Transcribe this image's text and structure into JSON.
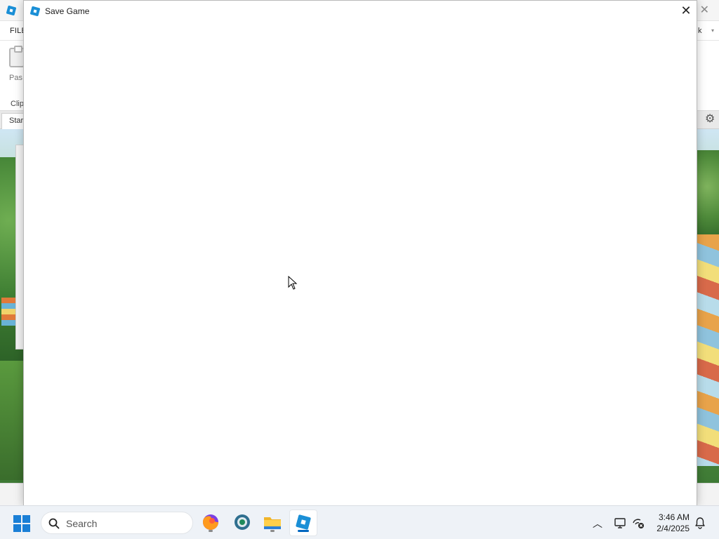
{
  "studio": {
    "menu": {
      "file": "FILE",
      "right_fragment": "k"
    },
    "ribbon": {
      "paste_label": "Pas",
      "clipboard_label": "Clip"
    },
    "tabs": [
      {
        "label": "Star"
      }
    ]
  },
  "dialog": {
    "title": "Save Game",
    "close_glyph": "✕"
  },
  "taskbar": {
    "search_placeholder": "Search",
    "apps": [
      {
        "name": "Firefox",
        "icon": "firefox-icon",
        "running": true
      },
      {
        "name": "Chrome-style browser",
        "icon": "browser-icon",
        "running": false
      },
      {
        "name": "File Explorer",
        "icon": "folder-icon",
        "running": true
      },
      {
        "name": "Roblox Studio",
        "icon": "roblox-studio-icon",
        "running": true,
        "active": true
      }
    ],
    "tray": {
      "time": "3:46 AM",
      "date": "2/4/2025"
    }
  },
  "colors": {
    "accent": "#0067c0",
    "roblox_blue": "#1a8fd6",
    "taskbar_bg": "#eef2f7"
  }
}
